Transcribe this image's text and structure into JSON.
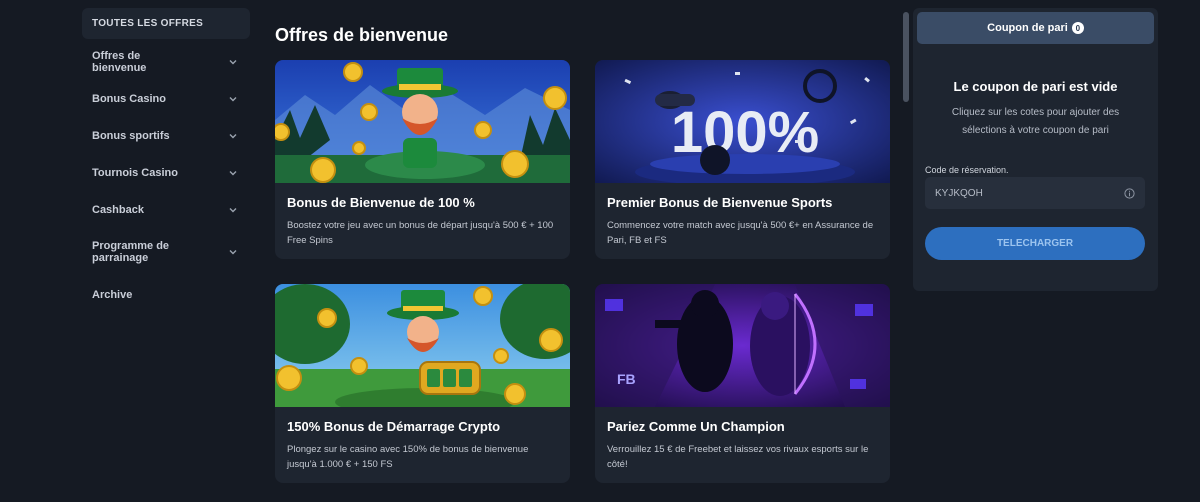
{
  "sidebar": {
    "header": "TOUTES LES OFFRES",
    "items": [
      {
        "label": "Offres de bienvenue"
      },
      {
        "label": "Bonus Casino"
      },
      {
        "label": "Bonus sportifs"
      },
      {
        "label": "Tournois Casino"
      },
      {
        "label": "Cashback"
      },
      {
        "label": "Programme de parrainage"
      },
      {
        "label": "Archive"
      }
    ]
  },
  "main": {
    "title": "Offres de bienvenue",
    "cards": [
      {
        "title": "Bonus de Bienvenue de 100 %",
        "description": "Boostez votre jeu avec un bonus de départ jusqu'à 500 € + 100 Free Spins",
        "image": "leprechaun-coins-image"
      },
      {
        "title": "Premier Bonus de Bienvenue Sports",
        "description": "Commencez votre match avec jusqu'à 500 €+ en Assurance de Pari, FB et FS",
        "image": "sports-100-percent-image",
        "image_text": "100%"
      },
      {
        "title": "150% Bonus de Démarrage Crypto",
        "description": "Plongez sur le casino avec 150% de bonus de bienvenue jusqu'à 1.000 € + 150 FS",
        "image": "leprechaun-slot-image"
      },
      {
        "title": "Pariez Comme Un Champion",
        "description": "Verrouillez 15 € de Freebet et laissez vos rivaux esports sur le côté!",
        "image": "esports-champion-image",
        "image_text": "FB"
      }
    ]
  },
  "coupon": {
    "tab_label": "Coupon de pari",
    "count": "0",
    "empty_title": "Le coupon de pari est vide",
    "hint": "Cliquez sur les cotes pour ajouter des sélections à votre coupon de pari",
    "code_label": "Code de réservation.",
    "code_value": "KYJKQOH",
    "download_label": "TELECHARGER"
  },
  "colors": {
    "background": "#151a23",
    "panel": "#1e2530",
    "accent": "#2d6fbf",
    "tab_active": "#3a4c66"
  }
}
